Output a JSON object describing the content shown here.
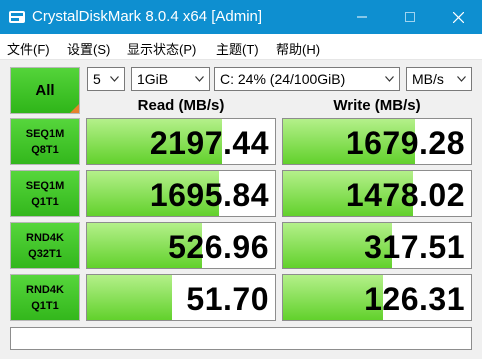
{
  "window": {
    "title": "CrystalDiskMark 8.0.4 x64 [Admin]"
  },
  "menu": [
    "文件(F)",
    "设置(S)",
    "显示状态(P)",
    "主题(T)",
    "帮助(H)"
  ],
  "controls": {
    "all_label": "All",
    "count": "5",
    "size": "1GiB",
    "drive": "C: 24% (24/100GiB)",
    "unit": "MB/s"
  },
  "headers": {
    "read": "Read (MB/s)",
    "write": "Write (MB/s)"
  },
  "rows": [
    {
      "line1": "SEQ1M",
      "line2": "Q8T1",
      "read": "2197.44",
      "write": "1679.28",
      "read_fill": 0.72,
      "write_fill": 0.7
    },
    {
      "line1": "SEQ1M",
      "line2": "Q1T1",
      "read": "1695.84",
      "write": "1478.02",
      "read_fill": 0.7,
      "write_fill": 0.69
    },
    {
      "line1": "RND4K",
      "line2": "Q32T1",
      "read": "526.96",
      "write": "317.51",
      "read_fill": 0.61,
      "write_fill": 0.58
    },
    {
      "line1": "RND4K",
      "line2": "Q1T1",
      "read": "51.70",
      "write": "126.31",
      "read_fill": 0.45,
      "write_fill": 0.53
    }
  ],
  "comment": "",
  "colors": {
    "titlebar": "#0e8fd0",
    "fill_top": "#b4f08a",
    "fill_bottom": "#62d12c",
    "label_green": "#33b71c",
    "corner_orange": "#e6822c"
  }
}
